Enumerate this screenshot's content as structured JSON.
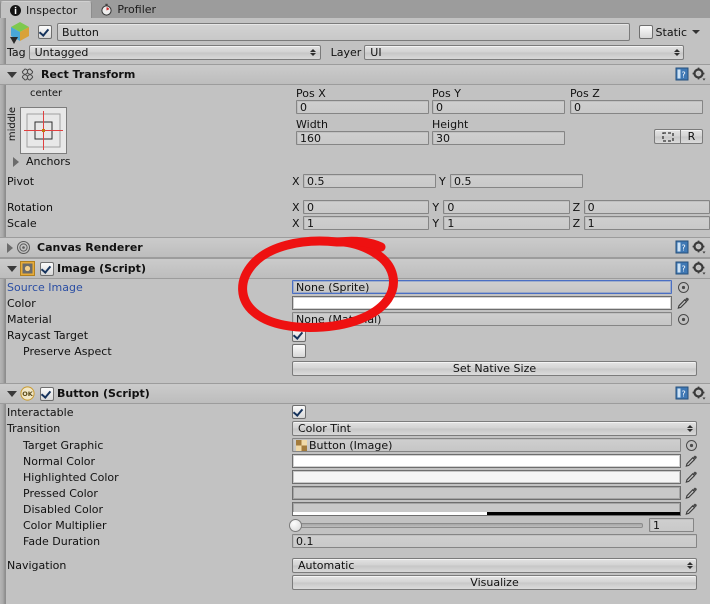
{
  "window": {
    "tabs": [
      {
        "label": "Inspector",
        "icon": "info-icon",
        "active": true
      },
      {
        "label": "Profiler",
        "icon": "stopwatch-icon",
        "active": false
      }
    ]
  },
  "object_header": {
    "icon": "prefab-cube-icon",
    "enabled": true,
    "name": "Button",
    "static_label": "Static",
    "static_checked": false,
    "tag_label": "Tag",
    "tag_value": "Untagged",
    "layer_label": "Layer",
    "layer_value": "UI"
  },
  "components": [
    {
      "id": "rect-transform",
      "title": "Rect Transform",
      "expanded": true,
      "icon": "rect-transform-icon",
      "anchor_preset": {
        "horizontal": "center",
        "vertical": "middle"
      },
      "pos_labels": [
        "Pos X",
        "Pos Y",
        "Pos Z"
      ],
      "pos_values": [
        "0",
        "0",
        "0"
      ],
      "size_labels": [
        "Width",
        "Height"
      ],
      "size_values": [
        "160",
        "30"
      ],
      "blueprint_button": "blueprint-icon",
      "raw_button": "R",
      "anchors_label": "Anchors",
      "pivot_label": "Pivot",
      "pivot_axes": [
        "X",
        "Y"
      ],
      "pivot_values": [
        "0.5",
        "0.5"
      ],
      "rotation_label": "Rotation",
      "rotation_axes": [
        "X",
        "Y",
        "Z"
      ],
      "rotation_values": [
        "0",
        "0",
        "0"
      ],
      "scale_label": "Scale",
      "scale_axes": [
        "X",
        "Y",
        "Z"
      ],
      "scale_values": [
        "1",
        "1",
        "1"
      ]
    },
    {
      "id": "canvas-renderer",
      "title": "Canvas Renderer",
      "expanded": false,
      "icon": "canvas-renderer-icon"
    },
    {
      "id": "image-script",
      "title": "Image (Script)",
      "expanded": true,
      "enabled": true,
      "icon": "image-script-icon",
      "rows": [
        {
          "label": "Source Image",
          "type": "object",
          "value": "None (Sprite)",
          "link": true,
          "selected": true
        },
        {
          "label": "Color",
          "type": "color",
          "value": "#ffffff"
        },
        {
          "label": "Material",
          "type": "object",
          "value": "None (Material)"
        },
        {
          "label": "Raycast Target",
          "type": "checkbox",
          "checked": true
        },
        {
          "label": "Preserve Aspect",
          "type": "checkbox",
          "checked": false,
          "indent": 1
        }
      ],
      "button": "Set Native Size"
    },
    {
      "id": "button-script",
      "title": "Button (Script)",
      "expanded": true,
      "enabled": true,
      "icon": "button-script-icon",
      "rows": [
        {
          "label": "Interactable",
          "type": "checkbox",
          "checked": true
        },
        {
          "label": "Transition",
          "type": "popup",
          "value": "Color Tint"
        },
        {
          "label": "Target Graphic",
          "type": "object",
          "value": "Button (Image)",
          "indent": 1,
          "icon": "sprite-thumb-icon"
        },
        {
          "label": "Normal Color",
          "type": "color",
          "value": "#ffffff",
          "indent": 1
        },
        {
          "label": "Highlighted Color",
          "type": "color",
          "value": "#f5f5f5",
          "indent": 1
        },
        {
          "label": "Pressed Color",
          "type": "color",
          "value": "#c8c8c8",
          "indent": 1
        },
        {
          "label": "Disabled Color",
          "type": "color",
          "value": "#c8c8c8",
          "alpha": 0.5,
          "indent": 1
        },
        {
          "label": "Color Multiplier",
          "type": "slider",
          "value": "1",
          "percent": 0,
          "indent": 1
        },
        {
          "label": "Fade Duration",
          "type": "text",
          "value": "0.1",
          "indent": 1
        },
        {
          "label": "Navigation",
          "type": "popup",
          "value": "Automatic"
        }
      ],
      "button": "Visualize"
    }
  ],
  "annotation": {
    "shape": "hand-drawn-oval",
    "color": "#ee1111",
    "targets": "Source Image / Color / Material fields"
  }
}
